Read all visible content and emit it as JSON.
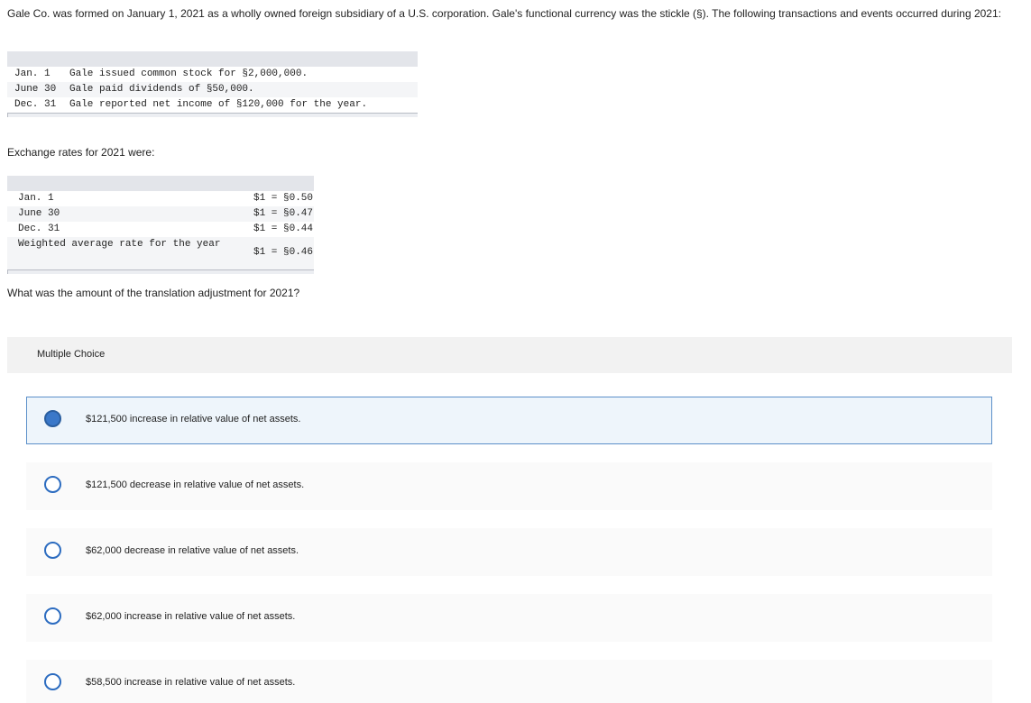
{
  "intro": "Gale Co. was formed on January 1, 2021 as a wholly owned foreign subsidiary of a U.S. corporation. Gale's functional currency was the stickle (§). The following transactions and events occurred during 2021:",
  "transactions": [
    {
      "date": "Jan. 1",
      "text": "Gale issued common stock for §2,000,000."
    },
    {
      "date": "June 30",
      "text": "Gale paid dividends of §50,000."
    },
    {
      "date": "Dec. 31",
      "text": "Gale reported net income of §120,000 for the year."
    }
  ],
  "exchange_label": "Exchange rates for 2021 were:",
  "rates": [
    {
      "date": "Jan. 1",
      "rate": "$1 = §0.50"
    },
    {
      "date": "June 30",
      "rate": "$1 = §0.47"
    },
    {
      "date": "Dec. 31",
      "rate": "$1 = §0.44"
    },
    {
      "date": "Weighted average rate for the year",
      "rate": "$1 = §0.46"
    }
  ],
  "question": "What was the amount of the translation adjustment for 2021?",
  "multiple_choice": {
    "header": "Multiple Choice",
    "selected_index": 0,
    "options": [
      "$121,500 increase in relative value of net assets.",
      "$121,500 decrease in relative value of net assets.",
      "$62,000 decrease in relative value of net assets.",
      "$62,000 increase in relative value of net assets.",
      "$58,500 increase in relative value of net assets."
    ]
  },
  "colors": {
    "radio_border": "#2c6cc0",
    "radio_selected_fill": "#3a78c9",
    "selected_border": "#5b8fc9",
    "selected_background": "#eef5fb"
  }
}
